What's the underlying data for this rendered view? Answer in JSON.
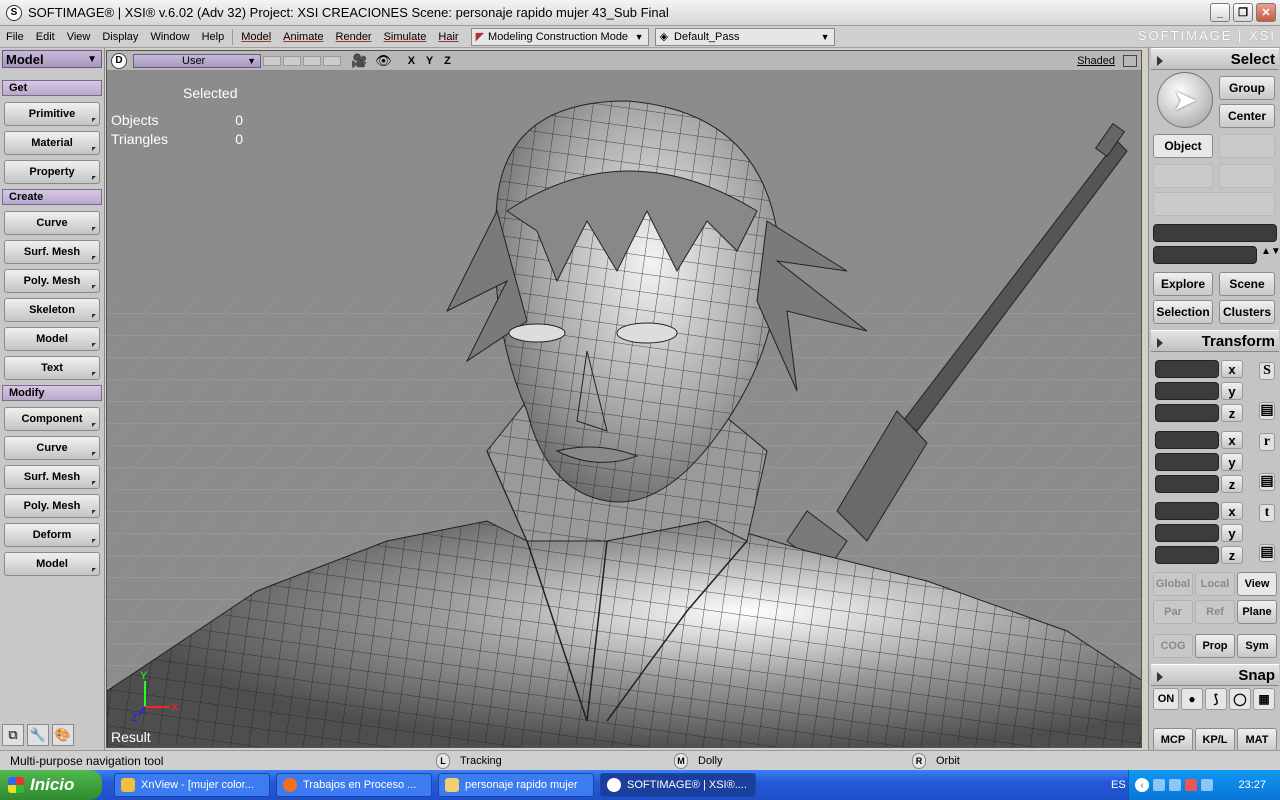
{
  "titlebar": {
    "title": "SOFTIMAGE® | XSI® v.6.02 (Adv 32) Project: XSI CREACIONES     Scene: personaje rapido mujer 43_Sub Final",
    "app_icon": "softimage-icon"
  },
  "menubar": {
    "items": [
      "File",
      "Edit",
      "View",
      "Display",
      "Window",
      "Help"
    ],
    "module_items": [
      "Model",
      "Animate",
      "Render",
      "Simulate",
      "Hair"
    ],
    "construction_mode": "Modeling Construction Mode",
    "render_pass": "Default_Pass",
    "brand": "SOFTIMAGE | XSI"
  },
  "left_panel": {
    "mode": "Model",
    "get": {
      "header": "Get",
      "buttons": [
        "Primitive",
        "Material",
        "Property"
      ]
    },
    "create": {
      "header": "Create",
      "buttons": [
        "Curve",
        "Surf. Mesh",
        "Poly. Mesh",
        "Skeleton",
        "Model",
        "Text"
      ]
    },
    "modify": {
      "header": "Modify",
      "buttons": [
        "Component",
        "Curve",
        "Surf. Mesh",
        "Poly. Mesh",
        "Deform",
        "Model"
      ]
    }
  },
  "viewport": {
    "letter": "D",
    "camera": "User",
    "axes": "X Y Z",
    "shading": "Shaded",
    "selected_label": "Selected",
    "objects_label": "Objects",
    "objects_value": "0",
    "triangles_label": "Triangles",
    "triangles_value": "0",
    "result_label": "Result",
    "gizmo": {
      "y": "Y",
      "x": "X",
      "z": "Z"
    }
  },
  "right_panel": {
    "select": {
      "header": "Select",
      "group": "Group",
      "center": "Center",
      "object": "Object"
    },
    "explore": "Explore",
    "scene": "Scene",
    "selection": "Selection",
    "clusters": "Clusters",
    "transform": {
      "header": "Transform",
      "axes": [
        "x",
        "y",
        "z"
      ],
      "badges": [
        "S",
        "r",
        "t"
      ],
      "global": "Global",
      "local": "Local",
      "view": "View",
      "par": "Par",
      "ref": "Ref",
      "plane": "Plane",
      "cog": "COG",
      "prop": "Prop",
      "sym": "Sym"
    },
    "snap": {
      "header": "Snap",
      "on": "ON",
      "mcp": "MCP",
      "kpl": "KP/L",
      "mat": "MAT"
    }
  },
  "statusbar": {
    "text": "Multi-purpose navigation tool",
    "left": {
      "key": "L",
      "label": "Tracking"
    },
    "middle": {
      "key": "M",
      "label": "Dolly"
    },
    "right": {
      "key": "R",
      "label": "Orbit"
    }
  },
  "taskbar": {
    "start": "Inicio",
    "tasks": [
      {
        "label": "XnView - [mujer color...",
        "color": "#f0c040"
      },
      {
        "label": "Trabajos en Proceso ...",
        "color": "#f07020"
      },
      {
        "label": "personaje rapido mujer",
        "color": "#f0d070"
      },
      {
        "label": "SOFTIMAGE® | XSI®....",
        "color": "#ffffff"
      }
    ],
    "lang": "ES",
    "clock": "23:27"
  }
}
